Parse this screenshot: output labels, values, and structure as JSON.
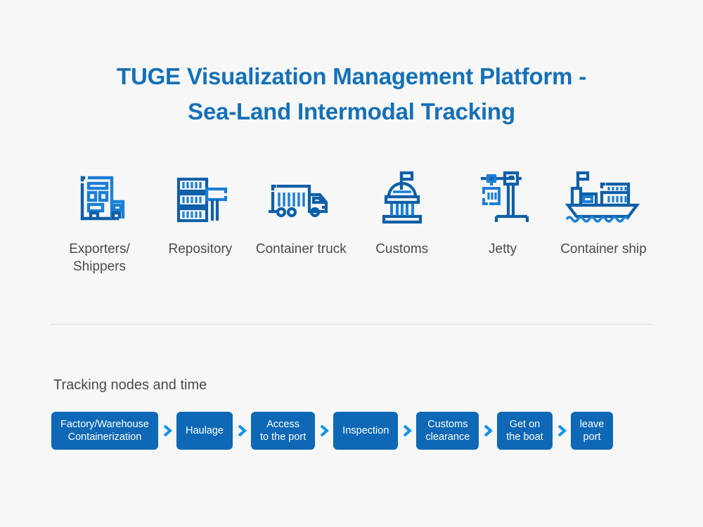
{
  "page": {
    "background_color": "#f7f7f7",
    "title_color": "#1470b8",
    "text_color": "#4a4a4a",
    "node_color": "#0e68b5",
    "chevron_color": "#0c92e8",
    "icon_dark_blue": "#0e5fa8",
    "icon_light_blue": "#1b7fd4"
  },
  "title": {
    "line1": "TUGE Visualization Management Platform -",
    "line2": "Sea-Land Intermodal Tracking"
  },
  "stages": [
    {
      "icon": "factory-building-icon",
      "label": "Exporters/\nShippers"
    },
    {
      "icon": "warehouse-containers-icon",
      "label": "Repository"
    },
    {
      "icon": "container-truck-icon",
      "label": "Container\ntruck"
    },
    {
      "icon": "customs-building-icon",
      "label": "Customs"
    },
    {
      "icon": "port-crane-icon",
      "label": "Jetty"
    },
    {
      "icon": "container-ship-icon",
      "label": "Container\nship"
    }
  ],
  "tracking": {
    "heading": "Tracking nodes and time",
    "separator_icon": "chevron-right-icon",
    "nodes": [
      {
        "label": "Factory/Warehouse\nContainerization"
      },
      {
        "label": "Haulage"
      },
      {
        "label": "Access\nto the port"
      },
      {
        "label": "Inspection"
      },
      {
        "label": "Customs\nclearance"
      },
      {
        "label": "Get on\nthe boat"
      },
      {
        "label": "leave\nport"
      }
    ]
  }
}
